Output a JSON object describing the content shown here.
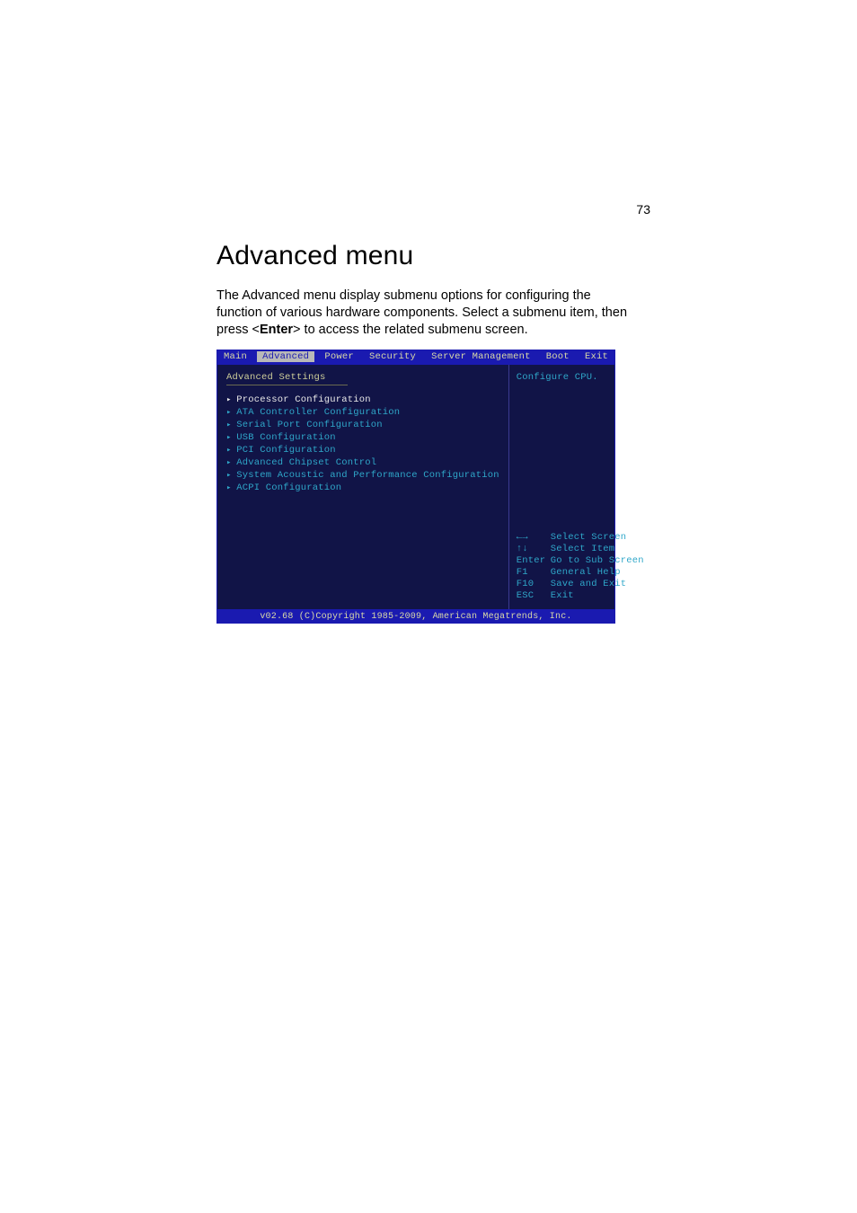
{
  "page": {
    "number": "73"
  },
  "heading": "Advanced menu",
  "paragraph": {
    "p1": "The Advanced menu display submenu options for configuring the function of various hardware components. Select a submenu item, then press <",
    "enter": "Enter",
    "p2": "> to access the related submenu screen."
  },
  "bios": {
    "tabs": {
      "main": "Main",
      "advanced": "Advanced",
      "power": "Power",
      "security": "Security",
      "server": "Server Management",
      "boot": "Boot",
      "exit": "Exit"
    },
    "left": {
      "title": "Advanced Settings",
      "items": [
        "Processor Configuration",
        "ATA Controller Configuration",
        "Serial Port Configuration",
        "USB Configuration",
        "PCI Configuration",
        "Advanced Chipset Control",
        "System Acoustic and Performance Configuration",
        "ACPI Configuration"
      ]
    },
    "right": {
      "help": "Configure CPU.",
      "keys": [
        {
          "k": "←→",
          "v": "Select Screen"
        },
        {
          "k": "↑↓",
          "v": "Select Item"
        },
        {
          "k": "Enter",
          "v": "Go to Sub Screen"
        },
        {
          "k": "F1",
          "v": "General Help"
        },
        {
          "k": "F10",
          "v": "Save and Exit"
        },
        {
          "k": "ESC",
          "v": "Exit"
        }
      ]
    },
    "footer": "v02.68 (C)Copyright 1985-2009, American Megatrends, Inc."
  }
}
